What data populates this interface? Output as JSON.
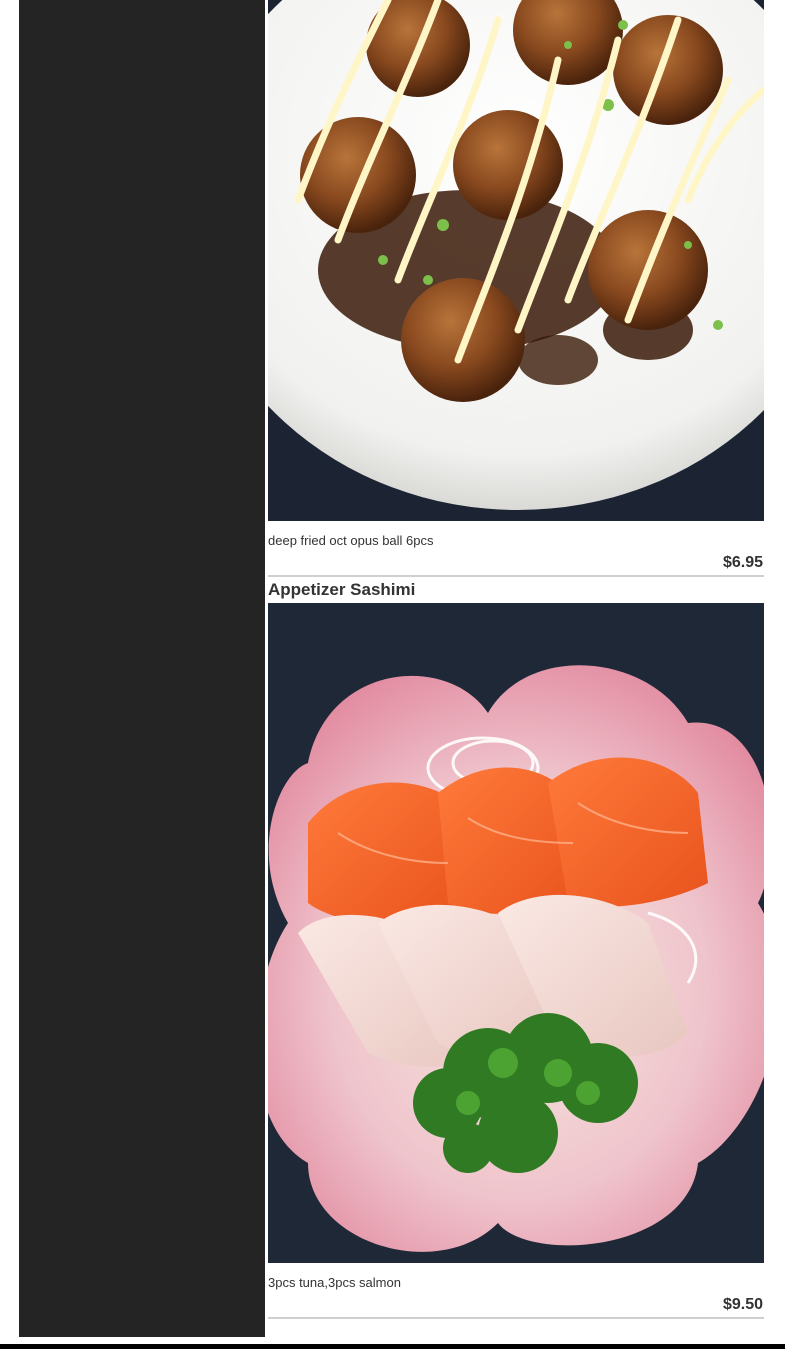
{
  "menu": {
    "items": [
      {
        "title": "",
        "description": "deep fried oct opus ball 6pcs",
        "price": "$6.95",
        "photo_icon": "takoyaki-photo"
      },
      {
        "title": "Appetizer Sashimi",
        "description": "3pcs tuna,3pcs salmon",
        "price": "$9.50",
        "photo_icon": "sashimi-photo"
      }
    ]
  },
  "colors": {
    "sidebar": "#242424",
    "text": "#333333",
    "divider": "#cfcfcf",
    "bottom_bar": "#000000"
  }
}
